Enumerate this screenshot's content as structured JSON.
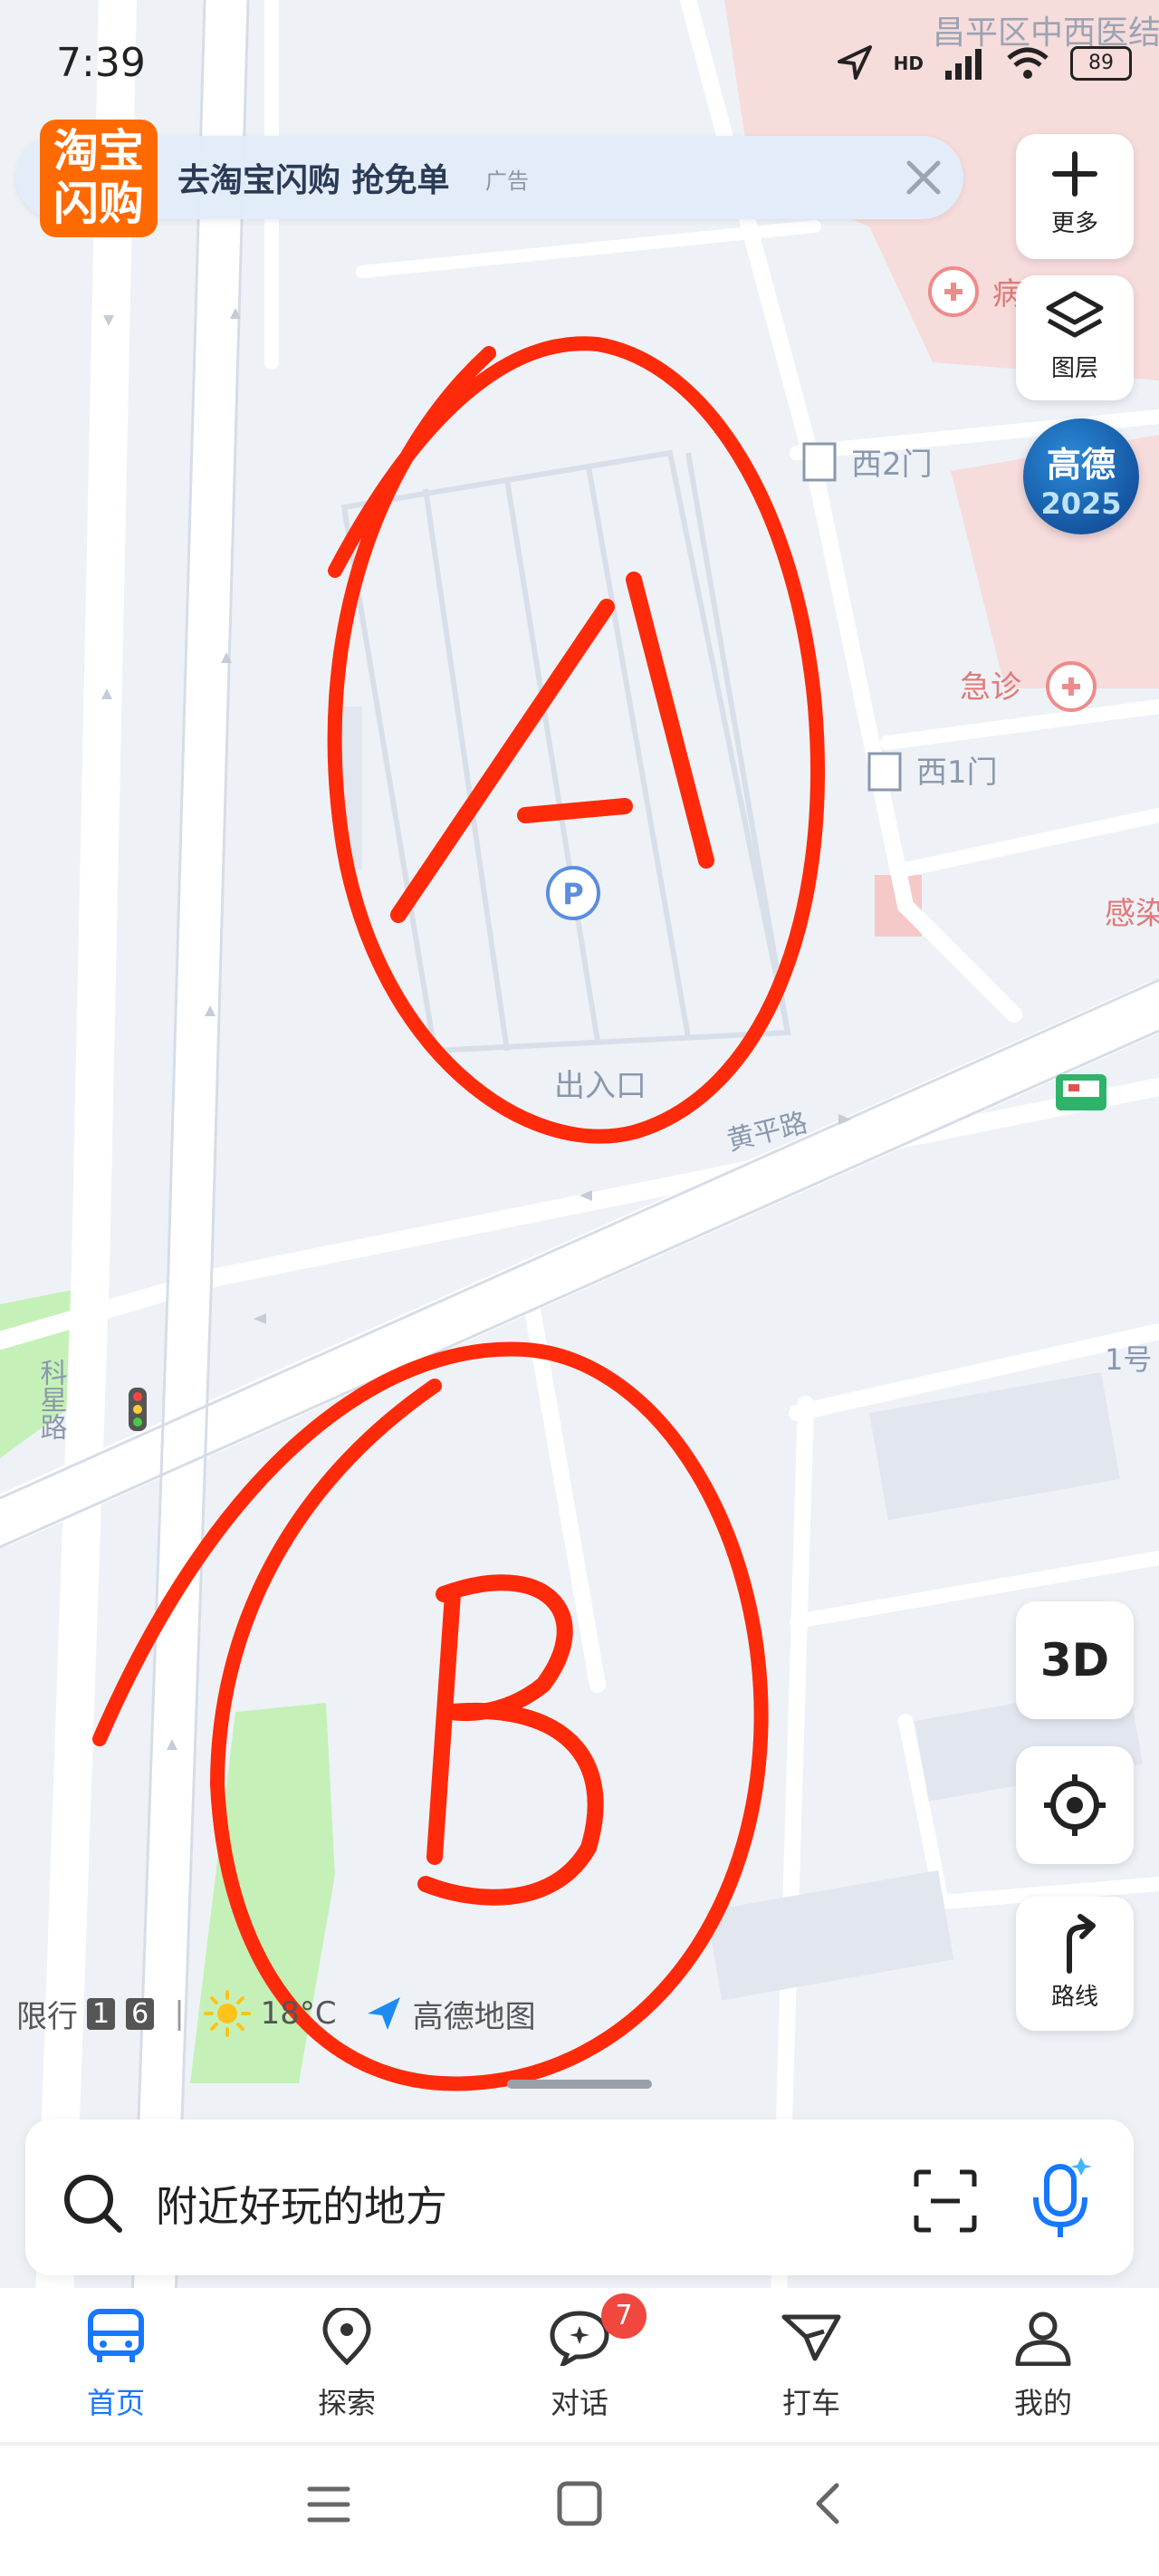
{
  "status_bar": {
    "time": "7:39",
    "network": "HD",
    "battery": "89"
  },
  "map": {
    "labels": {
      "district": "昌平区中西医结",
      "gate2": "西2门",
      "gate1": "西1门",
      "emergency": "急诊",
      "hospital_partial": "病",
      "infect_partial": "感染",
      "entrance": "出入口",
      "road_huangping": "黄平路",
      "road_kexing": "科星路",
      "num_partial": "1号"
    },
    "annotations": {
      "letter_a": "A",
      "letter_b": "B"
    },
    "colors": {
      "annotation": "#ff2a0a",
      "background": "#eef2f7",
      "hospital": "#f7d6d6",
      "green": "#c5f1b8",
      "road": "#ffffff"
    }
  },
  "ad": {
    "logo_line1": "淘宝",
    "logo_line2": "闪购",
    "text": "去淘宝闪购 抢免单",
    "tag": "广告",
    "close_icon": "close-icon"
  },
  "controls": {
    "more_label": "更多",
    "layers_label": "图层",
    "gaode_line1": "高德",
    "gaode_line2": "2025",
    "view_3d": "3D",
    "route_label": "路线"
  },
  "info_bar": {
    "restriction_label": "限行",
    "restriction_nums": [
      "1",
      "6"
    ],
    "separator": "|",
    "temperature": "18°C",
    "brand": "高德地图"
  },
  "search": {
    "placeholder": "附近好玩的地方"
  },
  "tabs": [
    {
      "label": "首页",
      "icon": "bus-icon",
      "active": true
    },
    {
      "label": "探索",
      "icon": "location-pin-icon",
      "active": false
    },
    {
      "label": "对话",
      "icon": "chat-icon",
      "active": false,
      "badge": "7"
    },
    {
      "label": "打车",
      "icon": "taxi-icon",
      "active": false
    },
    {
      "label": "我的",
      "icon": "profile-icon",
      "active": false
    }
  ],
  "accent_color": "#1677ff"
}
